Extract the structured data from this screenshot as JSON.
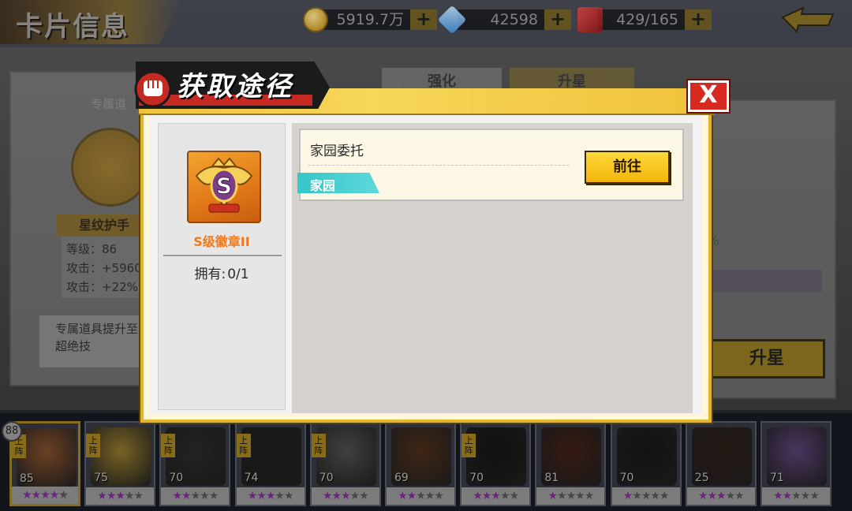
{
  "screen": {
    "title": "卡片信息",
    "resources": {
      "gold": "5919.7万",
      "diamonds": "42598",
      "cards": "429/165",
      "add_symbol": "+"
    },
    "tabs": [
      "强化",
      "升星"
    ],
    "exclusive_item": {
      "section_title": "专属道",
      "name": "星纹护手",
      "level_label": "等级：",
      "level_value": "86",
      "attack_flat": "攻击：+5960",
      "attack_pct": "攻击：+22%",
      "description_line1": "专属道具提升至",
      "description_line2": "超绝技"
    },
    "right_panel": {
      "percent_fragment": "%",
      "upgrade_button": "升星"
    }
  },
  "dialog": {
    "title": "获取途径",
    "close_symbol": "X",
    "item": {
      "name": "S级徽章II",
      "own_label": "拥有:",
      "own_value": "0/1"
    },
    "sources": [
      {
        "name": "家园委托",
        "tag": "家园",
        "button": "前往"
      }
    ]
  },
  "hero_bar": {
    "menu_symbol": "88",
    "heroes": [
      {
        "level": "85",
        "stars": 4,
        "deployed": true,
        "selected": true,
        "color": "#b56b3c",
        "tag": "上阵"
      },
      {
        "level": "75",
        "stars": 3,
        "deployed": true,
        "selected": false,
        "color": "#c9a53c",
        "tag": "上阵"
      },
      {
        "level": "70",
        "stars": 2,
        "deployed": true,
        "selected": false,
        "color": "#3a3a3a",
        "tag": "上阵"
      },
      {
        "level": "74",
        "stars": 3,
        "deployed": true,
        "selected": false,
        "color": "#2a2a2a",
        "tag": "上阵"
      },
      {
        "level": "70",
        "stars": 3,
        "deployed": true,
        "selected": false,
        "color": "#6c6c6c",
        "tag": "上阵"
      },
      {
        "level": "69",
        "stars": 2,
        "deployed": false,
        "selected": false,
        "color": "#6a4024",
        "tag": ""
      },
      {
        "level": "70",
        "stars": 3,
        "deployed": true,
        "selected": false,
        "color": "#1c1c1c",
        "tag": "上阵"
      },
      {
        "level": "81",
        "stars": 1,
        "deployed": false,
        "selected": false,
        "color": "#5a2a20",
        "tag": ""
      },
      {
        "level": "70",
        "stars": 1,
        "deployed": false,
        "selected": false,
        "color": "#202020",
        "tag": ""
      },
      {
        "level": "25",
        "stars": 3,
        "deployed": false,
        "selected": false,
        "color": "#3e2a22",
        "tag": ""
      },
      {
        "level": "71",
        "stars": 2,
        "deployed": false,
        "selected": false,
        "color": "#7a5aa0",
        "tag": ""
      }
    ]
  },
  "colors": {
    "accent_gold": "#e4b42c",
    "close_red": "#d62a20",
    "tag_cyan": "#33c7c9",
    "item_name_orange": "#ef7a1f"
  }
}
